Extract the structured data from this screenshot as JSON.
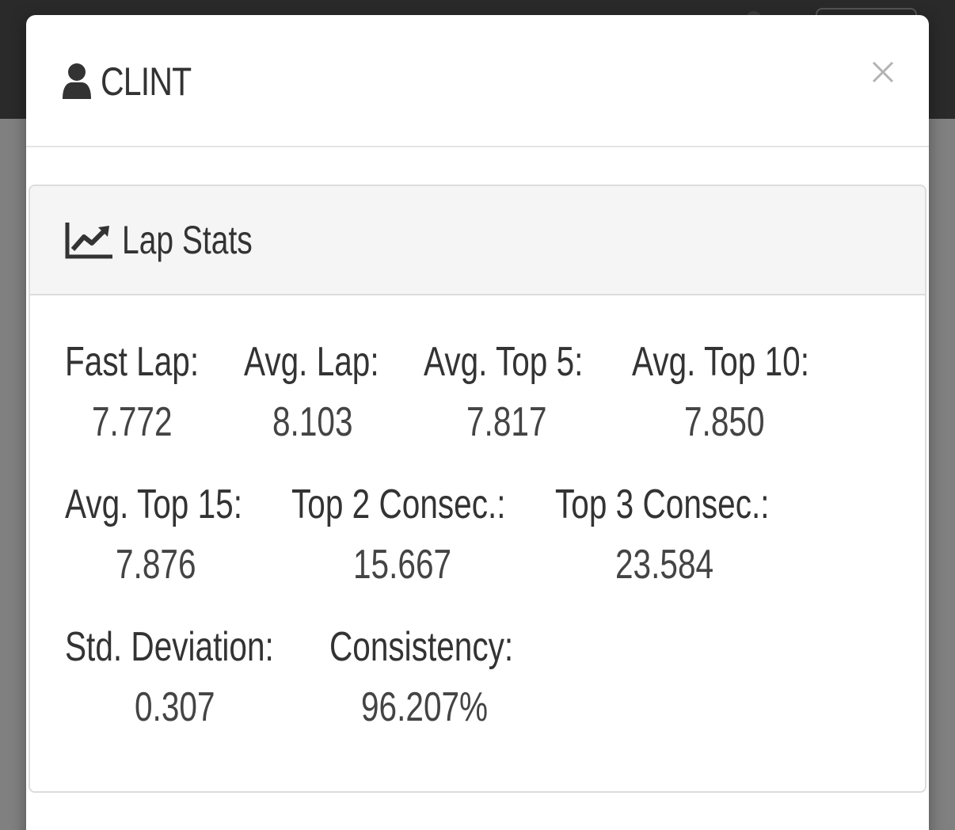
{
  "modal": {
    "title": "CLINT",
    "close_symbol": "×",
    "icons": {
      "title_icon": "user-icon",
      "close_icon": "close-icon"
    }
  },
  "panel": {
    "title": "Lap Stats",
    "icon": "line-chart-icon",
    "stats": [
      {
        "label": "Fast Lap:",
        "value": "7.772"
      },
      {
        "label": "Avg. Lap:",
        "value": "8.103"
      },
      {
        "label": "Avg. Top 5:",
        "value": "7.817"
      },
      {
        "label": "Avg. Top 10:",
        "value": "7.850"
      },
      {
        "label": "Avg. Top 15:",
        "value": "7.876"
      },
      {
        "label": "Top 2 Consec.:",
        "value": "15.667"
      },
      {
        "label": "Top 3 Consec.:",
        "value": "23.584"
      },
      {
        "label": "Std. Deviation:",
        "value": "0.307"
      },
      {
        "label": "Consistency:",
        "value": "96.207%"
      }
    ]
  },
  "colors": {
    "text": "#333333",
    "panel_heading_bg": "#f5f5f5",
    "overlay": "#808080",
    "topbar": "#2a2a2a"
  }
}
